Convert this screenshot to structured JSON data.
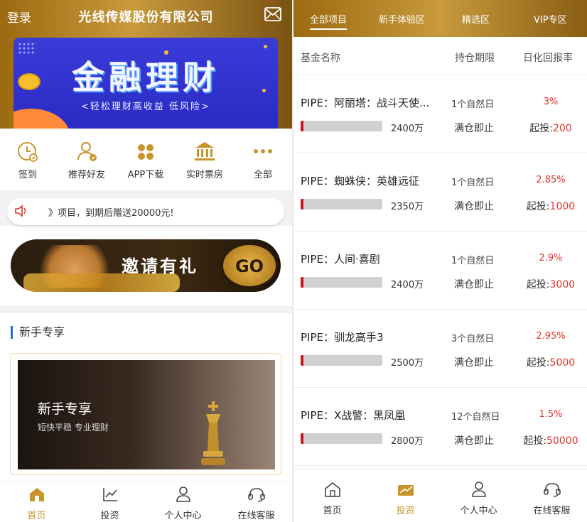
{
  "left": {
    "header": {
      "login": "登录",
      "title": "光线传媒股份有限公司"
    },
    "banner": {
      "title": "金融理财",
      "subtitle": "<轻松理财高收益  低风险>"
    },
    "icons": [
      {
        "icon": "clock-check-icon",
        "label": "签到"
      },
      {
        "icon": "user-check-icon",
        "label": "推荐好友"
      },
      {
        "icon": "clover-icon",
        "label": "APP下载"
      },
      {
        "icon": "bank-icon",
        "label": "实时票房"
      },
      {
        "icon": "more-dots-icon",
        "label": "全部"
      }
    ],
    "notice": {
      "text": "》项目，到期后赠送20000元!"
    },
    "invite": {
      "title": "邀请有礼",
      "go": "GO"
    },
    "section_title": "新手专享",
    "card": {
      "title": "新手专享",
      "subtitle": "短快平稳  专业理财"
    },
    "nav": [
      {
        "icon": "home-icon",
        "label": "首页",
        "active": true
      },
      {
        "icon": "chart-icon",
        "label": "投资",
        "active": false
      },
      {
        "icon": "user-icon",
        "label": "个人中心",
        "active": false
      },
      {
        "icon": "headset-icon",
        "label": "在线客服",
        "active": false
      }
    ]
  },
  "right": {
    "tabs": [
      {
        "label": "全部项目",
        "active": true
      },
      {
        "label": "新手体验区",
        "active": false
      },
      {
        "label": "精选区",
        "active": false
      },
      {
        "label": "VIP专区",
        "active": false
      }
    ],
    "columns": {
      "name": "基金名称",
      "period": "持仓期限",
      "rate": "日化回报率"
    },
    "funds": [
      {
        "name": "PIPE：阿丽塔：战斗天使...",
        "period": "1个自然日",
        "rate": "3%",
        "amount": "2400万",
        "status": "满仓即止",
        "min_label": "起投:",
        "min": "200",
        "progress": 0.03
      },
      {
        "name": "PIPE：蜘蛛侠：英雄远征",
        "period": "1个自然日",
        "rate": "2.85%",
        "amount": "2350万",
        "status": "满仓即止",
        "min_label": "起投:",
        "min": "1000",
        "progress": 0.03
      },
      {
        "name": "PIPE：人间·喜剧",
        "period": "1个自然日",
        "rate": "2.9%",
        "amount": "2400万",
        "status": "满仓即止",
        "min_label": "起投:",
        "min": "3000",
        "progress": 0.03
      },
      {
        "name": "PIPE：驯龙高手3",
        "period": "3个自然日",
        "rate": "2.95%",
        "amount": "2500万",
        "status": "满仓即止",
        "min_label": "起投:",
        "min": "5000",
        "progress": 0.03
      },
      {
        "name": "PIPE：X战警：黑凤凰",
        "period": "12个自然日",
        "rate": "1.5%",
        "amount": "2800万",
        "status": "满仓即止",
        "min_label": "起投:",
        "min": "50000",
        "progress": 0.03
      }
    ],
    "nav": [
      {
        "icon": "home-icon",
        "label": "首页",
        "active": false
      },
      {
        "icon": "invest-icon",
        "label": "投资",
        "active": true
      },
      {
        "icon": "user-icon",
        "label": "个人中心",
        "active": false
      },
      {
        "icon": "headset-icon",
        "label": "在线客服",
        "active": false
      }
    ]
  },
  "colors": {
    "gold": "#b8862a",
    "red": "#e0342c",
    "bar_red": "#c8161d",
    "blue_accent": "#1e6fd9"
  }
}
